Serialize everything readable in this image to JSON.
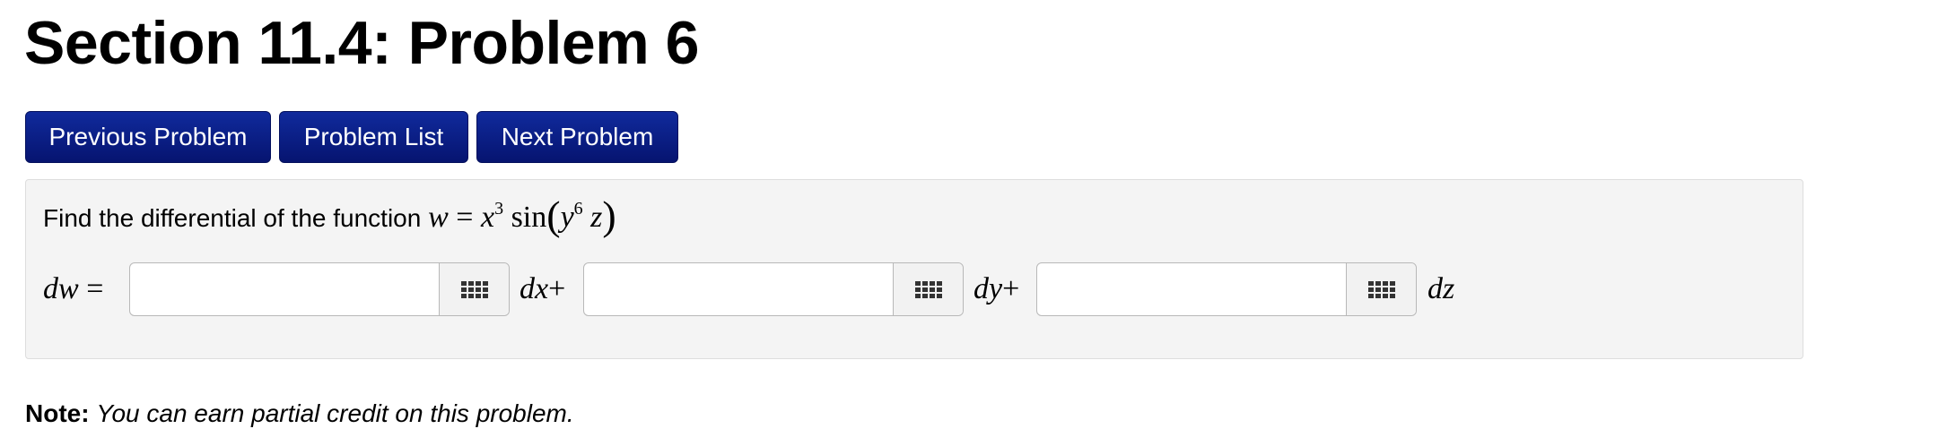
{
  "page": {
    "title": "Section 11.4: Problem 6"
  },
  "nav": {
    "previous": "Previous Problem",
    "list": "Problem List",
    "next": "Next Problem"
  },
  "problem": {
    "prompt": "Find the differential of the function",
    "function": {
      "w": "w",
      "equals": "=",
      "x": "x",
      "x_exp": "3",
      "sin": "sin",
      "y": "y",
      "y_exp": "6",
      "z": "z"
    },
    "lhs": {
      "d": "d",
      "w": "w",
      "equals": "="
    },
    "answers": [
      {
        "value": "",
        "placeholder": "",
        "suffix_d": "d",
        "suffix_var": "x",
        "suffix_op": "+"
      },
      {
        "value": "",
        "placeholder": "",
        "suffix_d": "d",
        "suffix_var": "y",
        "suffix_op": "+"
      },
      {
        "value": "",
        "placeholder": "",
        "suffix_d": "d",
        "suffix_var": "z",
        "suffix_op": ""
      }
    ],
    "input_tool_icon": "grid-icon"
  },
  "note": {
    "label": "Note:",
    "text": "You can earn partial credit on this problem."
  }
}
